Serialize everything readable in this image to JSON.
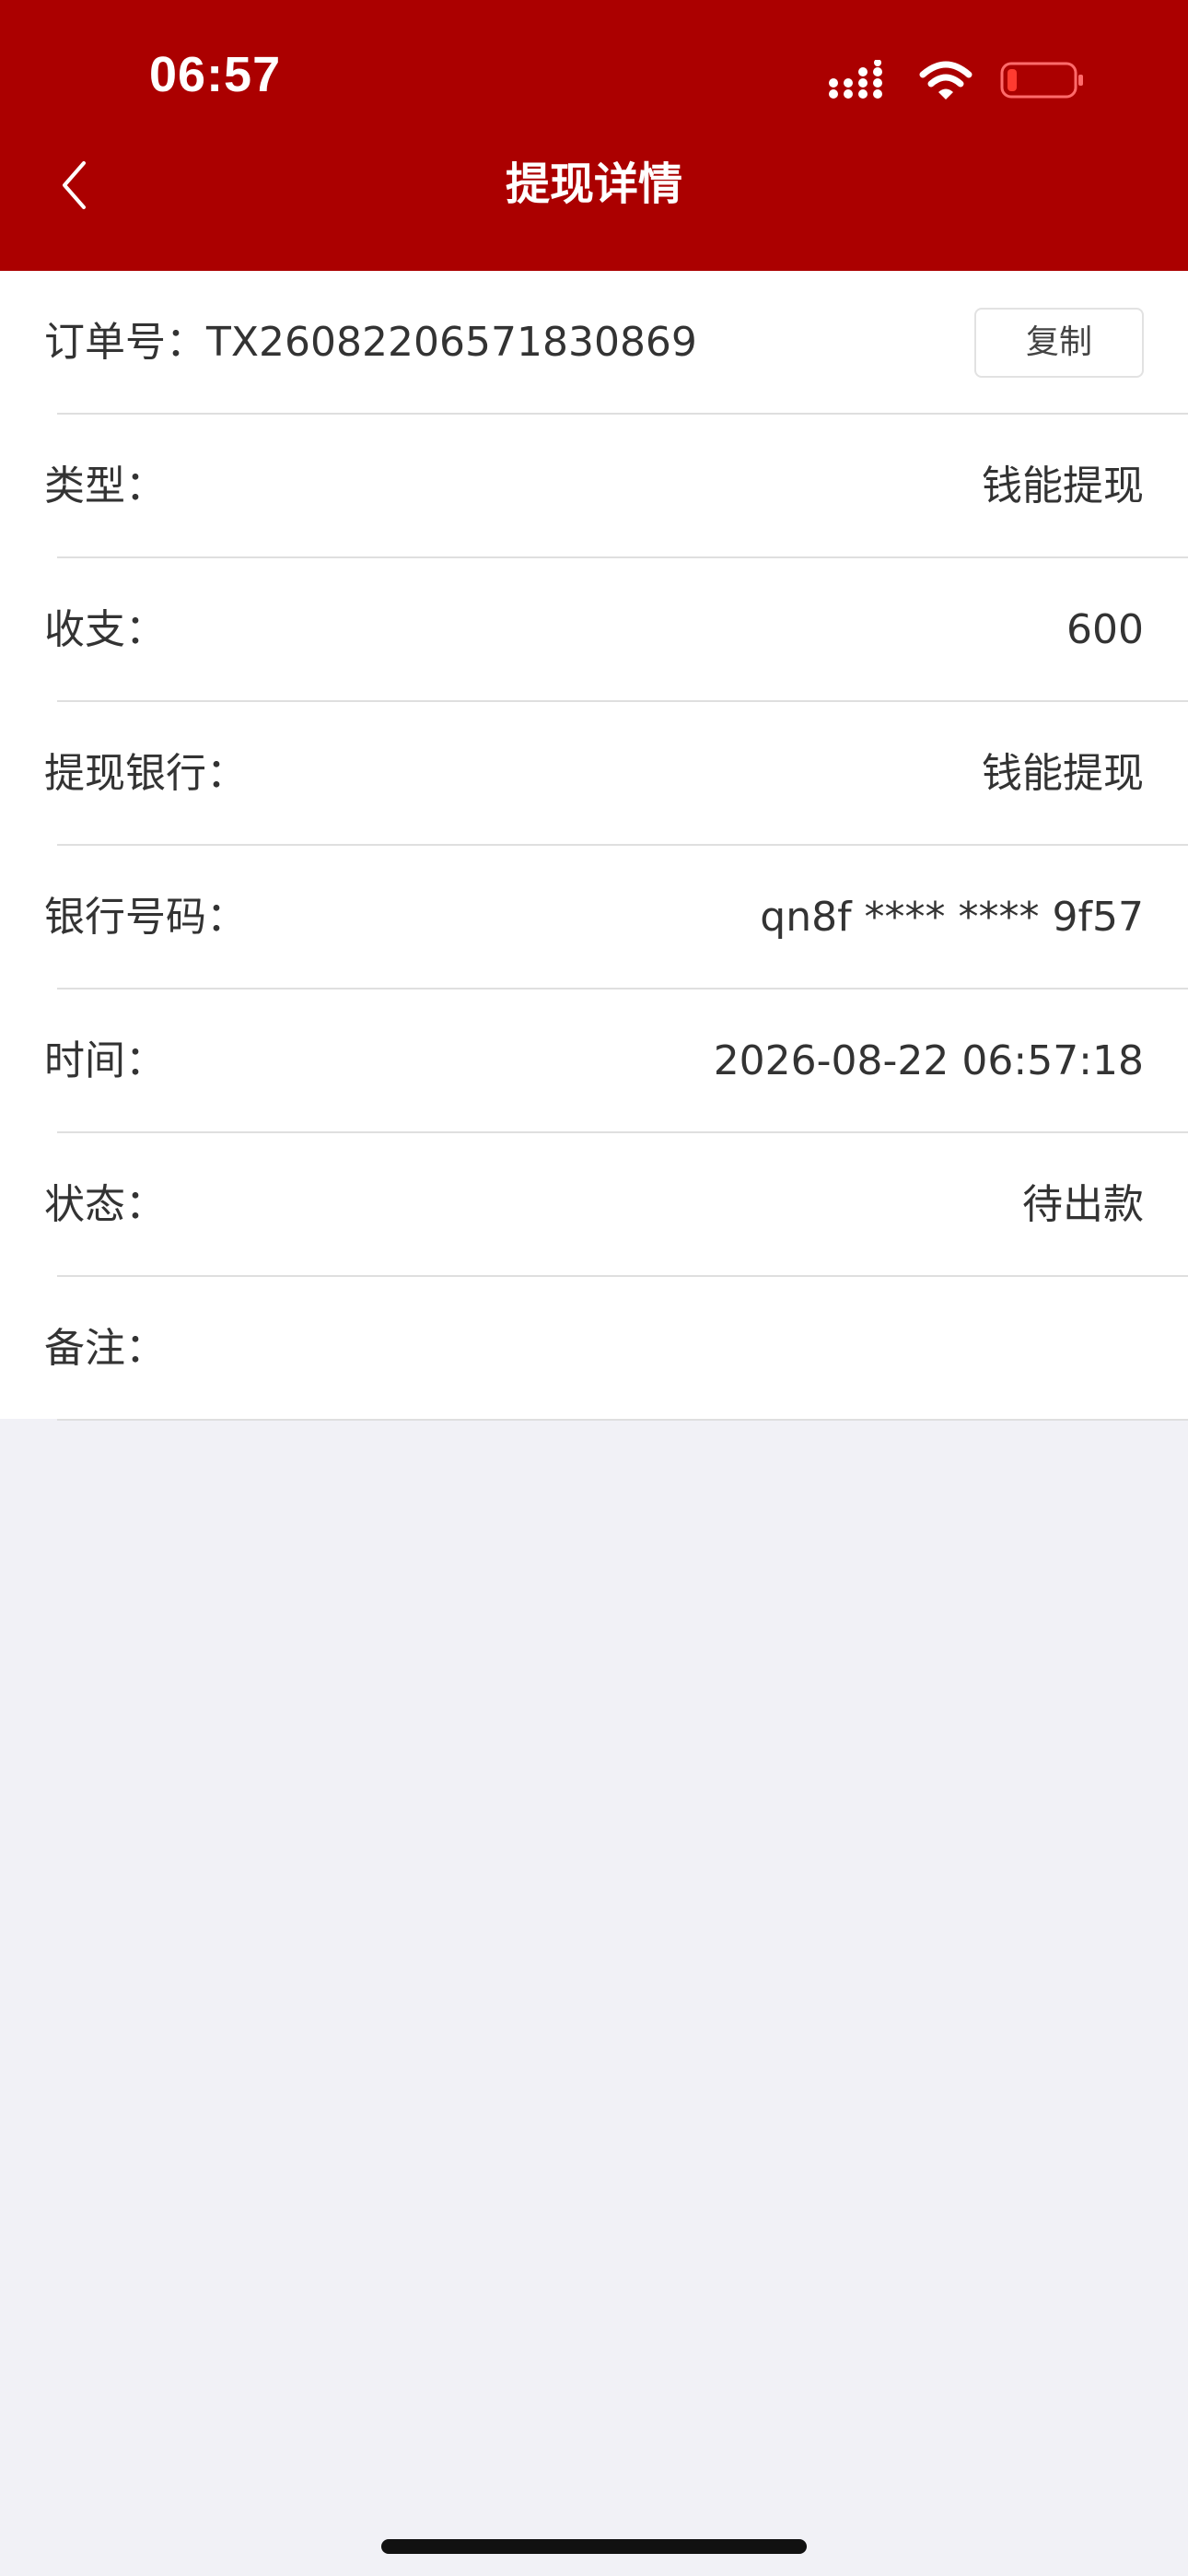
{
  "status_bar": {
    "time": "06:57",
    "icons": [
      "signal-icon",
      "wifi-icon",
      "battery-icon"
    ],
    "battery_color": "#ff3b30"
  },
  "header": {
    "title": "提现详情",
    "back_icon": "chevron-left-icon",
    "background_color": "#ab0000"
  },
  "order": {
    "label": "订单号：",
    "number": "TX26082206571830869",
    "copy_label": "复制"
  },
  "rows": [
    {
      "label": "类型：",
      "value": "钱能提现"
    },
    {
      "label": "收支：",
      "value": "600"
    },
    {
      "label": "提现银行：",
      "value": "钱能提现"
    },
    {
      "label": "银行号码：",
      "value": "qn8f **** **** 9f57"
    },
    {
      "label": "时间：",
      "value": "2026-08-22 06:57:18"
    },
    {
      "label": "状态：",
      "value": "待出款"
    },
    {
      "label": "备注：",
      "value": ""
    }
  ]
}
